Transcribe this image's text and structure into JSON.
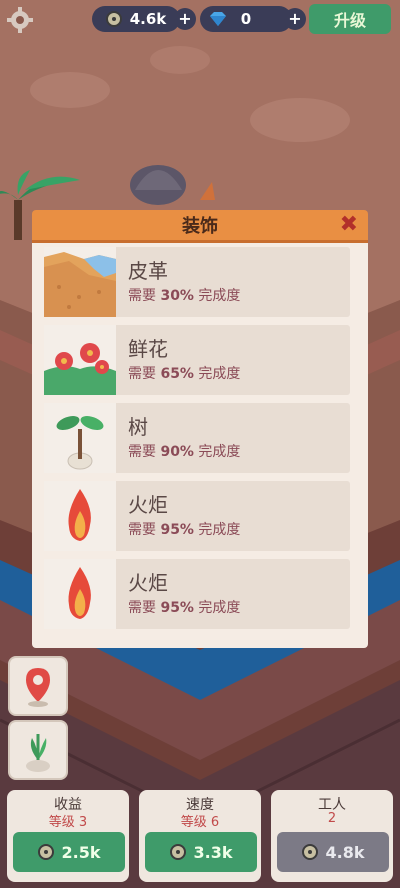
{
  "hud": {
    "coins": "4.6k",
    "gems": "0",
    "plus": "+",
    "upgrade_label": "升级"
  },
  "modal": {
    "title": "装饰",
    "close": "✖",
    "items": [
      {
        "name": "皮革",
        "prefix": "需要",
        "percent": "30%",
        "suffix": "完成度",
        "icon": "leather-icon"
      },
      {
        "name": "鲜花",
        "prefix": "需要",
        "percent": "65%",
        "suffix": "完成度",
        "icon": "flower-icon"
      },
      {
        "name": "树",
        "prefix": "需要",
        "percent": "90%",
        "suffix": "完成度",
        "icon": "tree-icon"
      },
      {
        "name": "火炬",
        "prefix": "需要",
        "percent": "95%",
        "suffix": "完成度",
        "icon": "torch-icon"
      },
      {
        "name": "火炬",
        "prefix": "需要",
        "percent": "95%",
        "suffix": "完成度",
        "icon": "torch-icon"
      }
    ]
  },
  "bottom": {
    "income": {
      "title": "收益",
      "level": "等级 3",
      "value": "2.5k"
    },
    "speed": {
      "title": "速度",
      "level": "等级 6",
      "value": "3.3k"
    },
    "workers": {
      "title": "工人",
      "level": "2",
      "value": "4.8k"
    }
  },
  "colors": {
    "accent_orange": "#e98f43",
    "button_green": "#3f9b6a",
    "hud_dark": "#3a3c57",
    "text_red": "#8b4b57"
  }
}
